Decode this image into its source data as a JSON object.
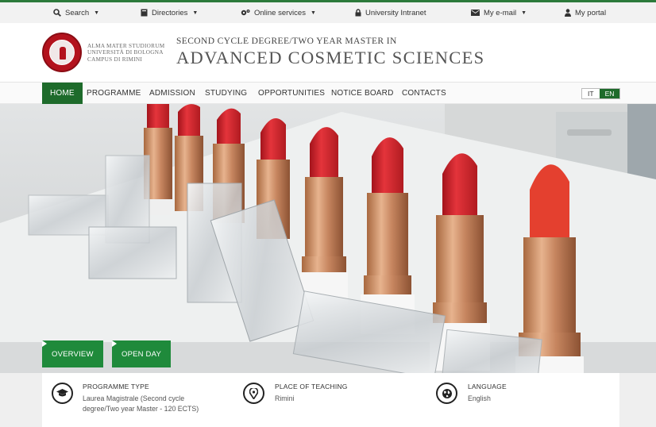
{
  "utility_bar": {
    "items": [
      {
        "label": "Search",
        "icon": "search-icon",
        "has_caret": true
      },
      {
        "label": "Directories",
        "icon": "book-icon",
        "has_caret": true
      },
      {
        "label": "Online services",
        "icon": "gears-icon",
        "has_caret": true
      },
      {
        "label": "University Intranet",
        "icon": "lock-icon",
        "has_caret": false
      },
      {
        "label": "My e-mail",
        "icon": "envelope-icon",
        "has_caret": true
      },
      {
        "label": "My portal",
        "icon": "user-icon",
        "has_caret": false
      }
    ],
    "caret": "▼"
  },
  "header": {
    "university_lines": [
      "ALMA MATER STUDIORUM",
      "UNIVERSITÀ DI BOLOGNA",
      "CAMPUS DI RIMINI"
    ],
    "degree_subtitle": "SECOND CYCLE DEGREE/TWO YEAR MASTER IN",
    "degree_title": "ADVANCED COSMETIC SCIENCES"
  },
  "nav": {
    "items": [
      "HOME",
      "PROGRAMME",
      "ADMISSION",
      "STUDYING",
      "OPPORTUNITIES",
      "NOTICE BOARD",
      "CONTACTS"
    ],
    "active": "HOME",
    "languages": [
      "IT",
      "EN"
    ],
    "active_language": "EN"
  },
  "hero": {
    "buttons": [
      {
        "label": "OVERVIEW",
        "icon": "triangle-right-icon"
      },
      {
        "label": "OPEN DAY",
        "icon": "triangle-right-icon"
      }
    ]
  },
  "info": {
    "blocks": [
      {
        "label": "PROGRAMME TYPE",
        "value": "Laurea Magistrale (Second cycle",
        "value2": "degree/Two year Master - 120 ECTS)",
        "icon": "graduation-cap-icon"
      },
      {
        "label": "PLACE OF TEACHING",
        "value": "Rimini",
        "icon": "map-pin-icon"
      },
      {
        "label": "LANGUAGE",
        "value": "English",
        "icon": "globe-icon"
      }
    ]
  },
  "colors": {
    "accent_green": "#1e6b2b",
    "button_green": "#1f8a3b",
    "top_border": "#2c7a3b",
    "seal_red": "#b3121d"
  }
}
